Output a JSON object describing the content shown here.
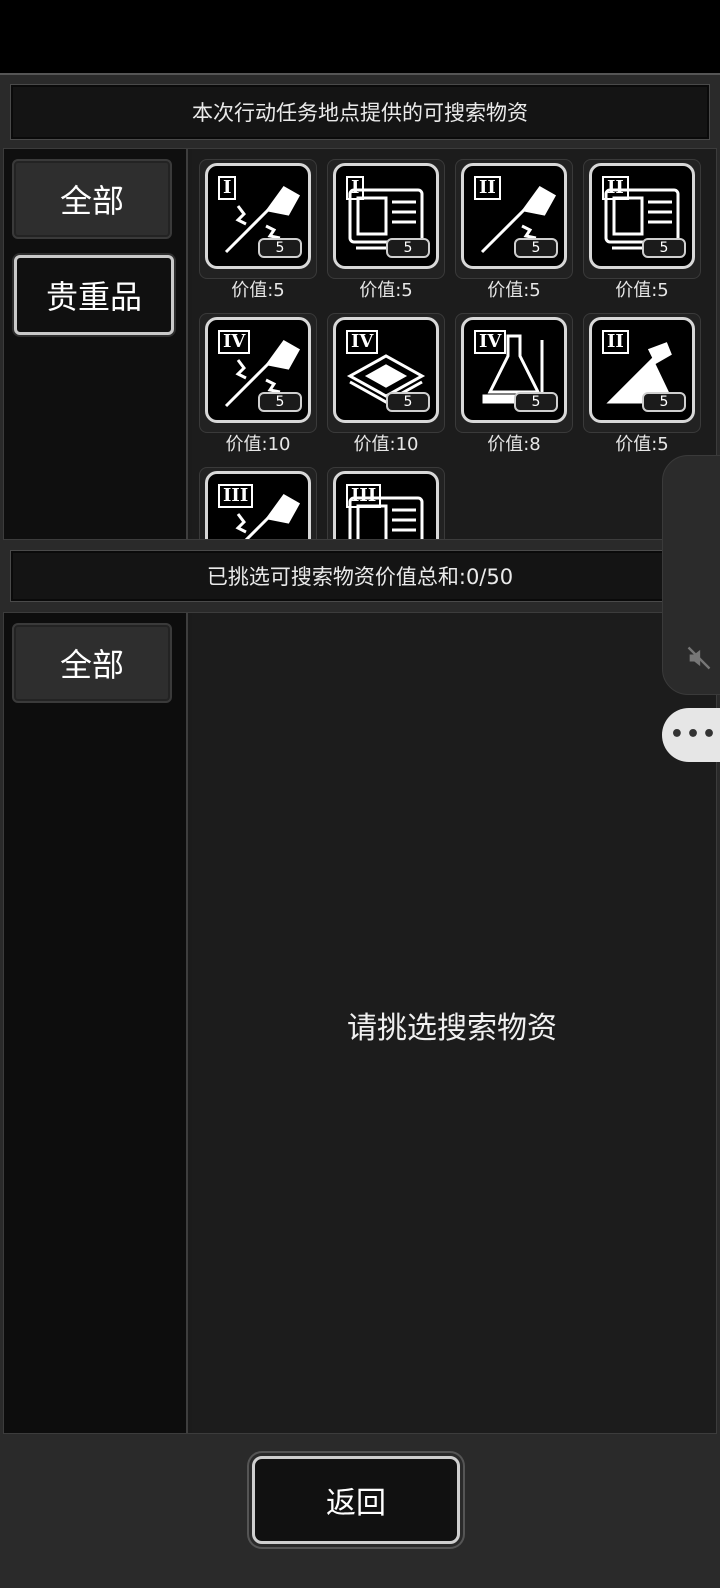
{
  "header": {
    "title": "本次行动任务地点提供的可搜索物资"
  },
  "top_categories": [
    {
      "label": "全部",
      "selected": false
    },
    {
      "label": "贵重品",
      "selected": true
    }
  ],
  "items": [
    {
      "tier": "I",
      "icon": "syringe-icon",
      "qty": "5",
      "value": "价值:5"
    },
    {
      "tier": "I",
      "icon": "machine-icon",
      "qty": "5",
      "value": "价值:5"
    },
    {
      "tier": "II",
      "icon": "syringe-icon",
      "qty": "5",
      "value": "价值:5"
    },
    {
      "tier": "II",
      "icon": "machine-icon",
      "qty": "5",
      "value": "价值:5"
    },
    {
      "tier": "IV",
      "icon": "syringe-icon",
      "qty": "5",
      "value": "价值:10"
    },
    {
      "tier": "IV",
      "icon": "chip-icon",
      "qty": "5",
      "value": "价值:10"
    },
    {
      "tier": "IV",
      "icon": "lab-equipment-icon",
      "qty": "5",
      "value": "价值:8"
    },
    {
      "tier": "II",
      "icon": "flask-icon",
      "qty": "5",
      "value": "价值:5"
    },
    {
      "tier": "III",
      "icon": "syringe-icon",
      "qty": "",
      "value": ""
    },
    {
      "tier": "III",
      "icon": "machine-icon",
      "qty": "",
      "value": ""
    }
  ],
  "summary": {
    "text": "已挑选可搜索物资价值总和:0/50"
  },
  "bottom_categories": [
    {
      "label": "全部"
    }
  ],
  "selection": {
    "empty_text": "请挑选搜索物资"
  },
  "footer": {
    "back_label": "返回"
  },
  "floating": {
    "more_icon": "more-icon",
    "mute_icon": "mute-icon"
  }
}
